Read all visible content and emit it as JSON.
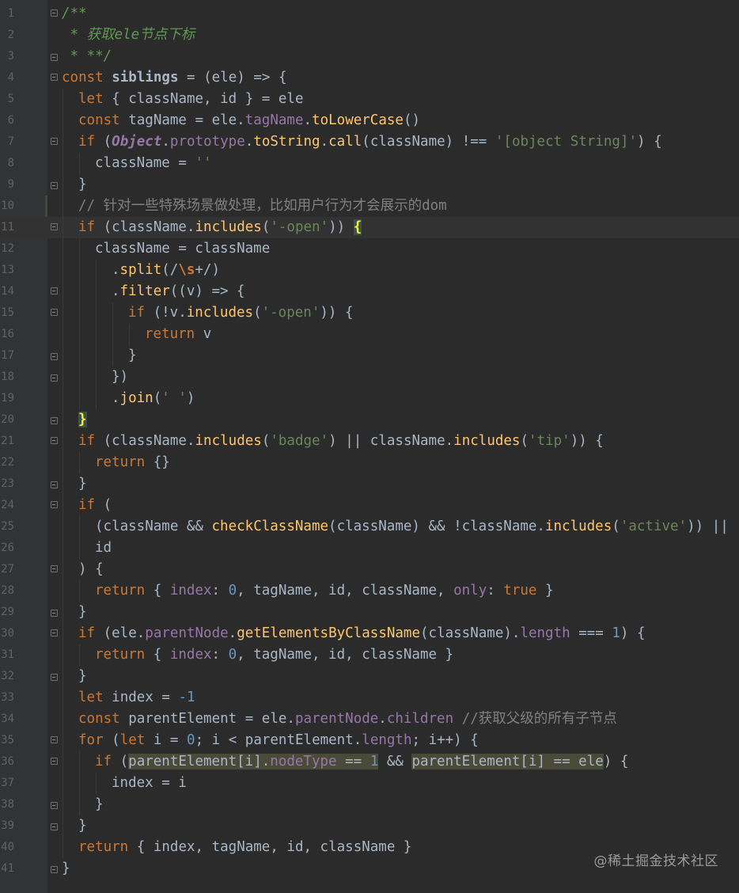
{
  "editor": {
    "colors": {
      "background": "#2b2b2b",
      "gutter": "#313335",
      "keyword": "#cc7832",
      "function": "#ffc66d",
      "string": "#6a8759",
      "number": "#6897bb",
      "comment": "#808080",
      "property": "#9876aa"
    },
    "current_line": 11,
    "lines": [
      {
        "n": "1",
        "fold": "open",
        "indent": 0,
        "tokens": [
          [
            "doc",
            "/**"
          ]
        ]
      },
      {
        "n": "2",
        "fold": "",
        "indent": 0,
        "tokens": [
          [
            "doc",
            " * 获取ele节点下标"
          ]
        ]
      },
      {
        "n": "3",
        "fold": "close",
        "indent": 0,
        "tokens": [
          [
            "doc",
            " * **/"
          ]
        ]
      },
      {
        "n": "4",
        "fold": "open",
        "indent": 0,
        "tokens": [
          [
            "kw",
            "const "
          ],
          [
            "plain-bold",
            "siblings"
          ],
          [
            "op",
            " = (ele) => {"
          ]
        ]
      },
      {
        "n": "5",
        "fold": "",
        "indent": 1,
        "tokens": [
          [
            "kw",
            "let "
          ],
          [
            "op",
            "{ className, id } = ele"
          ]
        ]
      },
      {
        "n": "6",
        "fold": "",
        "indent": 1,
        "tokens": [
          [
            "kw",
            "const "
          ],
          [
            "op",
            "tagName = ele."
          ],
          [
            "prop",
            "tagName"
          ],
          [
            "op",
            "."
          ],
          [
            "fn",
            "toLowerCase"
          ],
          [
            "op",
            "()"
          ]
        ]
      },
      {
        "n": "7",
        "fold": "open",
        "indent": 1,
        "tokens": [
          [
            "kw",
            "if "
          ],
          [
            "op",
            "("
          ],
          [
            "cls",
            "Object"
          ],
          [
            "op",
            "."
          ],
          [
            "prop",
            "prototype"
          ],
          [
            "op",
            "."
          ],
          [
            "fn",
            "toString"
          ],
          [
            "op",
            "."
          ],
          [
            "fn",
            "call"
          ],
          [
            "op",
            "(className) !== "
          ],
          [
            "str",
            "'[object String]'"
          ],
          [
            "op",
            ") {"
          ]
        ]
      },
      {
        "n": "8",
        "fold": "",
        "indent": 2,
        "tokens": [
          [
            "op",
            "className = "
          ],
          [
            "str",
            "''"
          ]
        ]
      },
      {
        "n": "9",
        "fold": "close",
        "indent": 1,
        "tokens": [
          [
            "op",
            "}"
          ]
        ]
      },
      {
        "n": "10",
        "fold": "",
        "indent": 1,
        "tokens": [
          [
            "cmt",
            "// 针对一些特殊场景做处理，比如用户行为才会展示的dom"
          ]
        ]
      },
      {
        "n": "11",
        "fold": "open",
        "indent": 1,
        "tokens": [
          [
            "kw",
            "if "
          ],
          [
            "op",
            "(className."
          ],
          [
            "fn",
            "includes"
          ],
          [
            "op",
            "("
          ],
          [
            "str",
            "'-open'"
          ],
          [
            "op",
            ")) "
          ],
          [
            "brace-hl",
            "{"
          ]
        ]
      },
      {
        "n": "12",
        "fold": "",
        "indent": 2,
        "tokens": [
          [
            "op",
            "className = className"
          ]
        ]
      },
      {
        "n": "13",
        "fold": "",
        "indent": 3,
        "tokens": [
          [
            "op",
            "."
          ],
          [
            "fn",
            "split"
          ],
          [
            "op",
            "(/"
          ],
          [
            "esc",
            "\\s"
          ],
          [
            "op",
            "+/)"
          ]
        ]
      },
      {
        "n": "14",
        "fold": "open",
        "indent": 3,
        "tokens": [
          [
            "op",
            "."
          ],
          [
            "fn",
            "filter"
          ],
          [
            "op",
            "((v) => {"
          ]
        ]
      },
      {
        "n": "15",
        "fold": "open",
        "indent": 4,
        "tokens": [
          [
            "kw",
            "if "
          ],
          [
            "op",
            "(!v."
          ],
          [
            "fn",
            "includes"
          ],
          [
            "op",
            "("
          ],
          [
            "str",
            "'-open'"
          ],
          [
            "op",
            ")) {"
          ]
        ]
      },
      {
        "n": "16",
        "fold": "",
        "indent": 5,
        "tokens": [
          [
            "kw",
            "return "
          ],
          [
            "op",
            "v"
          ]
        ]
      },
      {
        "n": "17",
        "fold": "close",
        "indent": 4,
        "tokens": [
          [
            "op",
            "}"
          ]
        ]
      },
      {
        "n": "18",
        "fold": "close",
        "indent": 3,
        "tokens": [
          [
            "op",
            "})"
          ]
        ]
      },
      {
        "n": "19",
        "fold": "",
        "indent": 3,
        "tokens": [
          [
            "op",
            "."
          ],
          [
            "fn",
            "join"
          ],
          [
            "op",
            "("
          ],
          [
            "str",
            "' '"
          ],
          [
            "op",
            ")"
          ]
        ]
      },
      {
        "n": "20",
        "fold": "close",
        "indent": 1,
        "tokens": [
          [
            "brace-hl",
            "}"
          ]
        ]
      },
      {
        "n": "21",
        "fold": "open",
        "indent": 1,
        "tokens": [
          [
            "kw",
            "if "
          ],
          [
            "op",
            "(className."
          ],
          [
            "fn",
            "includes"
          ],
          [
            "op",
            "("
          ],
          [
            "str",
            "'badge'"
          ],
          [
            "op",
            ") || className."
          ],
          [
            "fn",
            "includes"
          ],
          [
            "op",
            "("
          ],
          [
            "str",
            "'tip'"
          ],
          [
            "op",
            ")) {"
          ]
        ]
      },
      {
        "n": "22",
        "fold": "",
        "indent": 2,
        "tokens": [
          [
            "kw",
            "return "
          ],
          [
            "op",
            "{}"
          ]
        ]
      },
      {
        "n": "23",
        "fold": "close",
        "indent": 1,
        "tokens": [
          [
            "op",
            "}"
          ]
        ]
      },
      {
        "n": "24",
        "fold": "open",
        "indent": 1,
        "tokens": [
          [
            "kw",
            "if "
          ],
          [
            "op",
            "("
          ]
        ]
      },
      {
        "n": "25",
        "fold": "",
        "indent": 2,
        "tokens": [
          [
            "op",
            "(className && "
          ],
          [
            "fn",
            "checkClassName"
          ],
          [
            "op",
            "(className) && !className."
          ],
          [
            "fn",
            "includes"
          ],
          [
            "op",
            "("
          ],
          [
            "str",
            "'active'"
          ],
          [
            "op",
            ")) ||"
          ]
        ]
      },
      {
        "n": "26",
        "fold": "",
        "indent": 2,
        "tokens": [
          [
            "op",
            "id"
          ]
        ]
      },
      {
        "n": "27",
        "fold": "open",
        "indent": 1,
        "tokens": [
          [
            "op",
            ") {"
          ]
        ]
      },
      {
        "n": "28",
        "fold": "",
        "indent": 2,
        "tokens": [
          [
            "kw",
            "return "
          ],
          [
            "op",
            "{ "
          ],
          [
            "prop",
            "index"
          ],
          [
            "op",
            ": "
          ],
          [
            "num",
            "0"
          ],
          [
            "op",
            ", tagName, id, className, "
          ],
          [
            "prop",
            "only"
          ],
          [
            "op",
            ": "
          ],
          [
            "kw",
            "true"
          ],
          [
            "op",
            " }"
          ]
        ]
      },
      {
        "n": "29",
        "fold": "close",
        "indent": 1,
        "tokens": [
          [
            "op",
            "}"
          ]
        ]
      },
      {
        "n": "30",
        "fold": "open",
        "indent": 1,
        "tokens": [
          [
            "kw",
            "if "
          ],
          [
            "op",
            "(ele."
          ],
          [
            "prop",
            "parentNode"
          ],
          [
            "op",
            "."
          ],
          [
            "fn",
            "getElementsByClassName"
          ],
          [
            "op",
            "(className)."
          ],
          [
            "prop",
            "length"
          ],
          [
            "op",
            " === "
          ],
          [
            "num",
            "1"
          ],
          [
            "op",
            ") {"
          ]
        ]
      },
      {
        "n": "31",
        "fold": "",
        "indent": 2,
        "tokens": [
          [
            "kw",
            "return "
          ],
          [
            "op",
            "{ "
          ],
          [
            "prop",
            "index"
          ],
          [
            "op",
            ": "
          ],
          [
            "num",
            "0"
          ],
          [
            "op",
            ", tagName, id, className }"
          ]
        ]
      },
      {
        "n": "32",
        "fold": "close",
        "indent": 1,
        "tokens": [
          [
            "op",
            "}"
          ]
        ]
      },
      {
        "n": "33",
        "fold": "",
        "indent": 1,
        "tokens": [
          [
            "kw",
            "let "
          ],
          [
            "op",
            "index = "
          ],
          [
            "num",
            "-1"
          ]
        ]
      },
      {
        "n": "34",
        "fold": "",
        "indent": 1,
        "tokens": [
          [
            "kw",
            "const "
          ],
          [
            "op",
            "parentElement = ele."
          ],
          [
            "prop",
            "parentNode"
          ],
          [
            "op",
            "."
          ],
          [
            "prop",
            "children"
          ],
          [
            "op",
            " "
          ],
          [
            "cmt",
            "//获取父级的所有子节点"
          ]
        ]
      },
      {
        "n": "35",
        "fold": "open",
        "indent": 1,
        "tokens": [
          [
            "kw",
            "for "
          ],
          [
            "op",
            "("
          ],
          [
            "kw",
            "let "
          ],
          [
            "op",
            "i = "
          ],
          [
            "num",
            "0"
          ],
          [
            "op",
            "; i < parentElement."
          ],
          [
            "prop",
            "length"
          ],
          [
            "op",
            "; i++) {"
          ]
        ]
      },
      {
        "n": "36",
        "fold": "open",
        "indent": 2,
        "tokens": [
          [
            "kw",
            "if "
          ],
          [
            "op",
            "("
          ],
          [
            "hl",
            "parentElement[i]."
          ],
          [
            "hl-prop",
            "nodeType"
          ],
          [
            "hl",
            " == "
          ],
          [
            "hl-num",
            "1"
          ],
          [
            "op",
            " && "
          ],
          [
            "hl",
            "parentElement[i] == ele"
          ],
          [
            "op",
            ") {"
          ]
        ]
      },
      {
        "n": "37",
        "fold": "",
        "indent": 3,
        "tokens": [
          [
            "op",
            "index = i"
          ]
        ]
      },
      {
        "n": "38",
        "fold": "close",
        "indent": 2,
        "tokens": [
          [
            "op",
            "}"
          ]
        ]
      },
      {
        "n": "39",
        "fold": "close",
        "indent": 1,
        "tokens": [
          [
            "op",
            "}"
          ]
        ]
      },
      {
        "n": "40",
        "fold": "",
        "indent": 1,
        "tokens": [
          [
            "kw",
            "return "
          ],
          [
            "op",
            "{ index, tagName, id, className }"
          ]
        ]
      },
      {
        "n": "41",
        "fold": "close",
        "indent": 0,
        "tokens": [
          [
            "op",
            "}"
          ]
        ]
      }
    ]
  },
  "watermark": {
    "text": "@稀土掘金技术社区"
  }
}
